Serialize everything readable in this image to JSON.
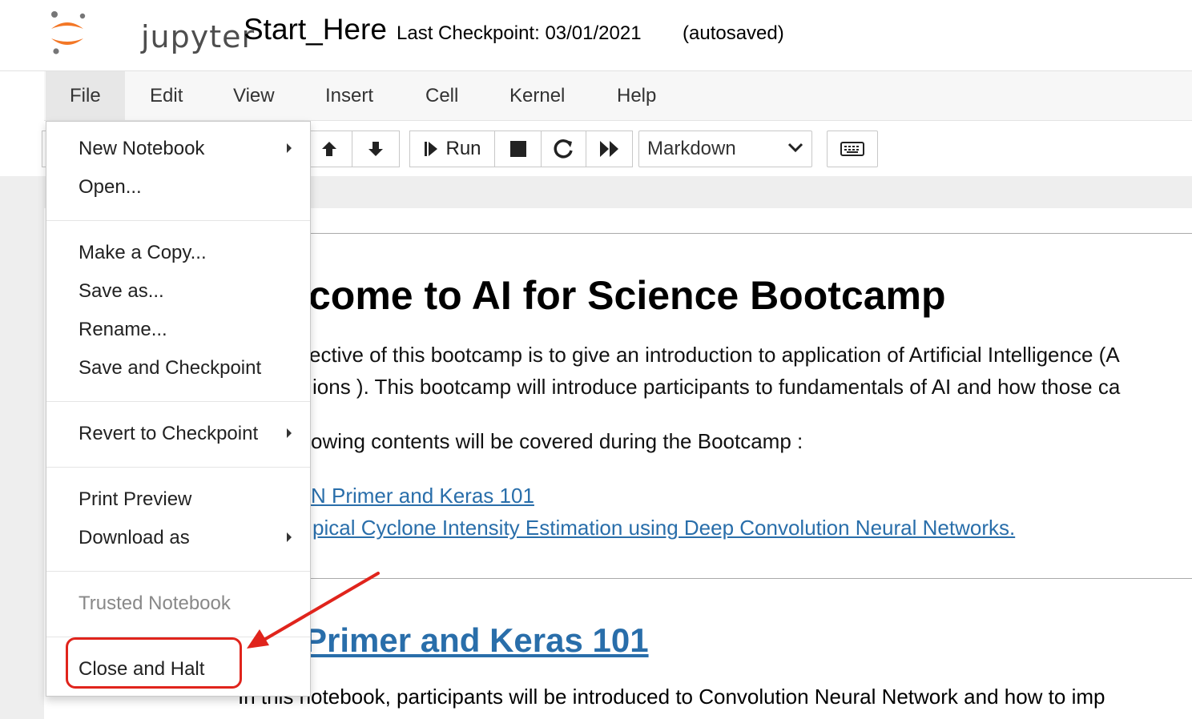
{
  "header": {
    "logo_text": "jupyter",
    "notebook_name": "Start_Here",
    "checkpoint_text": "Last Checkpoint: 03/01/2021",
    "autosave_status": "(autosaved)"
  },
  "menubar": {
    "items": [
      "File",
      "Edit",
      "View",
      "Insert",
      "Cell",
      "Kernel",
      "Help"
    ]
  },
  "toolbar": {
    "run_label": "Run",
    "cell_type": "Markdown",
    "icons": [
      "move-up-icon",
      "move-down-icon",
      "run-icon",
      "stop-icon",
      "restart-icon",
      "fast-forward-icon",
      "keyboard-icon"
    ]
  },
  "file_menu": {
    "items": [
      {
        "label": "New Notebook",
        "submenu": true
      },
      {
        "label": "Open..."
      },
      {
        "label": "Make a Copy..."
      },
      {
        "label": "Save as..."
      },
      {
        "label": "Rename..."
      },
      {
        "label": "Save and Checkpoint"
      },
      {
        "label": "Revert to Checkpoint",
        "submenu": true
      },
      {
        "label": "Print Preview"
      },
      {
        "label": "Download as",
        "submenu": true
      },
      {
        "label": "Trusted Notebook",
        "disabled": true
      },
      {
        "label": "Close and Halt",
        "highlighted": true
      }
    ]
  },
  "notebook": {
    "title": "come to AI for Science Bootcamp",
    "intro_line1": "ective of this bootcamp is to give an introduction to application of Artificial Intelligence (A",
    "intro_line2": "ions ). This bootcamp will introduce participants to fundamentals of AI and how those ca",
    "contents_line": "owing contents will be covered during the Bootcamp :",
    "links": [
      "N Primer and Keras 101",
      "pical Cyclone Intensity Estimation using Deep Convolution Neural Networks."
    ],
    "section_title": "Primer and Keras 101",
    "bottom_line": "In this notebook, participants will be introduced to Convolution Neural Network and how to imp"
  },
  "colors": {
    "annotation_red": "#e0241c",
    "link_blue": "#296eaa",
    "jupyter_orange": "#f37726"
  }
}
